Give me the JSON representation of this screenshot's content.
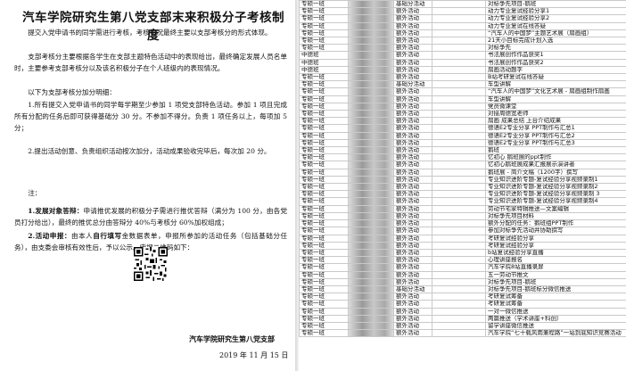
{
  "doc": {
    "title": "汽车学院研究生第八党支部末来积极分子考核制度",
    "intro": "提交入党申请书的同学需进行考核，考核情况最终主要以支部考核分的形式体现。",
    "para1": "支部考核分主要根据各学生在支部主题特色活动中的表现给出，最终确定发展人员名单时，主要参考支部考核分以及该名积极分子在个人班级内的表现情况。",
    "para2": "以下为支部考核分加分明细：",
    "item1": "1.所有提交入党申请书的同学每学期至少参加 1 项党支部特色活动。参加 1 项且完成所有分配的任务后即可获得基础分 30 分。不参加不得分。负责 1 项任务以上，每项加 5 分；",
    "item2": "2.提出活动创意、负责组织活动按次加分，活动成果验收完毕后，每次加 20 分。",
    "note_label": "注：",
    "note1_bold": "1.发展对象答辩：",
    "note1_text": "申请推优发展的积极分子需进行推优答辩（满分为 100 分，由各党员打分给出），最终的推优总分由答辩分 40%与考核分 60%加权组成；",
    "note2_bold": "2.活动申报：",
    "note2_bold2": "自行填写",
    "note2_pre": "由本人",
    "note2_text": "金数据表单，申报所参加的活动任务（包括基础分任务），由支委会审核有效性后，予以公示。申报二维码如下：",
    "signature": "汽车学院研究生第八党支部",
    "date": "2019 年 11 月 15 日"
  },
  "sheet": {
    "rows": [
      [
        "专硕一班",
        "",
        "基础分活动",
        "",
        "对标争先项目-鹅班"
      ],
      [
        "专硕一班",
        "",
        "额外活动",
        "",
        "动力专业复试经验分享1"
      ],
      [
        "专硕一班",
        "",
        "额外活动",
        "",
        "动力专业复试经验分享2"
      ],
      [
        "专硕一班",
        "",
        "额外活动",
        "",
        "动力专业复试在线答疑"
      ],
      [
        "专硕一班",
        "",
        "额外活动",
        "",
        "“汽车人的中国梦”主题艺术展（扇画组）"
      ],
      [
        "专硕一班",
        "",
        "额外活动",
        "",
        "21天小目标完成计划入选"
      ],
      [
        "专硕一班",
        "",
        "额外活动",
        "",
        "对标争先"
      ],
      [
        "中德班",
        "",
        "额外活动",
        "",
        "书法展创作作品获奖1"
      ],
      [
        "中德班",
        "",
        "额外活动",
        "",
        "书法展创作作品获奖2"
      ],
      [
        "中德班",
        "",
        "额外活动",
        "",
        "扇画活动题字"
      ],
      [
        "专硕一班",
        "",
        "额外活动",
        "",
        "B站考研复试在线答疑"
      ],
      [
        "专硕一班",
        "",
        "基础分活动",
        "",
        "车型讲解"
      ],
      [
        "专硕一班",
        "",
        "额外活动",
        "",
        "“汽车人的中国梦”文化艺术展 - 扇画组制作扇画"
      ],
      [
        "专硕一班",
        "",
        "额外活动",
        "",
        "车型讲解"
      ],
      [
        "专硕一班",
        "",
        "额外活动",
        "",
        "党员微课堂"
      ],
      [
        "专硕一班",
        "",
        "额外活动",
        "",
        "对接周德宽老师"
      ],
      [
        "专硕一班",
        "",
        "额外活动",
        "",
        "扇画    成果总结    上台介绍成果"
      ],
      [
        "专硕一班",
        "",
        "额外活动",
        "",
        "德语E2专业分享      PPT制作与汇总1"
      ],
      [
        "专硕一班",
        "",
        "额外活动",
        "",
        "德语E2专业分享      PPT制作与汇总2"
      ],
      [
        "专硕一班",
        "",
        "额外活动",
        "",
        "德语E2专业分享      PPT制作与汇总3"
      ],
      [
        "专硕一班",
        "",
        "额外活动",
        "",
        "鹅班"
      ],
      [
        "专硕一班",
        "",
        "额外活动",
        "",
        "忆初心 鹅班展的ppt制作"
      ],
      [
        "专硕一班",
        "",
        "额外活动",
        "",
        "忆初心鹅班展成果汇报展示演讲者"
      ],
      [
        "专硕一班",
        "",
        "额外活动",
        "",
        "鹅班展 - 简介文稿（1200字）撰写"
      ],
      [
        "专硕一班",
        "",
        "额外活动",
        "",
        "专业知识进阶专题-复试经验分享视频录制1"
      ],
      [
        "专硕一班",
        "",
        "额外活动",
        "",
        "专业知识进阶专题-复试经验分享视频录制2"
      ],
      [
        "专硕一班",
        "",
        "额外活动",
        "",
        "专业知识进阶专题-复试经验分享视频录制 3"
      ],
      [
        "专硕一班",
        "",
        "额外活动",
        "",
        "专业知识进阶专题-复试经验分享视频录制4"
      ],
      [
        "专硕一班",
        "",
        "额外活动",
        "",
        "劳动节宅家特辑推送—文案编辑"
      ],
      [
        "专硕一班",
        "",
        "额外活动",
        "",
        "对标争先项目材料"
      ],
      [
        "专硕一班",
        "",
        "额外活动",
        "",
        "额外分配的任务：鹅班组PPT制作"
      ],
      [
        "专硕一班",
        "",
        "额外活动",
        "",
        "参加对标争先活动并协助撰写"
      ],
      [
        "专硕一班",
        "",
        "额外活动",
        "",
        "考研复试经验分享"
      ],
      [
        "专硕一班",
        "",
        "额外活动",
        "",
        "考研复试经验分享"
      ],
      [
        "专硕一班",
        "",
        "额外活动",
        "",
        "b站复试经验分享直播"
      ],
      [
        "专硕一班",
        "",
        "额外活动",
        "",
        "心理讲座报名"
      ],
      [
        "专硕一班",
        "",
        "额外活动",
        "",
        "汽车学院8站直播录屏"
      ],
      [
        "专硕一班",
        "",
        "额外活动",
        "",
        "五一劳动节推文"
      ],
      [
        "专硕一班",
        "",
        "额外活动",
        "",
        "对标争先项目-鹅班"
      ],
      [
        "专硕一班",
        "",
        "基础分活动",
        "",
        "对标争先项目-鹅班标分微信推送"
      ],
      [
        "专硕一班",
        "",
        "额外活动",
        "",
        "考研复试筹备"
      ],
      [
        "专硕一班",
        "",
        "额外活动",
        "",
        "考研复试筹备"
      ],
      [
        "专硕一班",
        "",
        "额外活动",
        "",
        "一对一微信推送"
      ],
      [
        "专硕一班",
        "",
        "额外活动",
        "",
        "两篇推送（学术讲座+科创）"
      ],
      [
        "专硕一班",
        "",
        "额外活动",
        "",
        "留学讲座微信推送"
      ],
      [
        "专硕一班",
        "",
        "额外活动",
        "",
        "汽车学院“七十载风雨兼程路”一站到底知识竞赛活动"
      ]
    ]
  }
}
